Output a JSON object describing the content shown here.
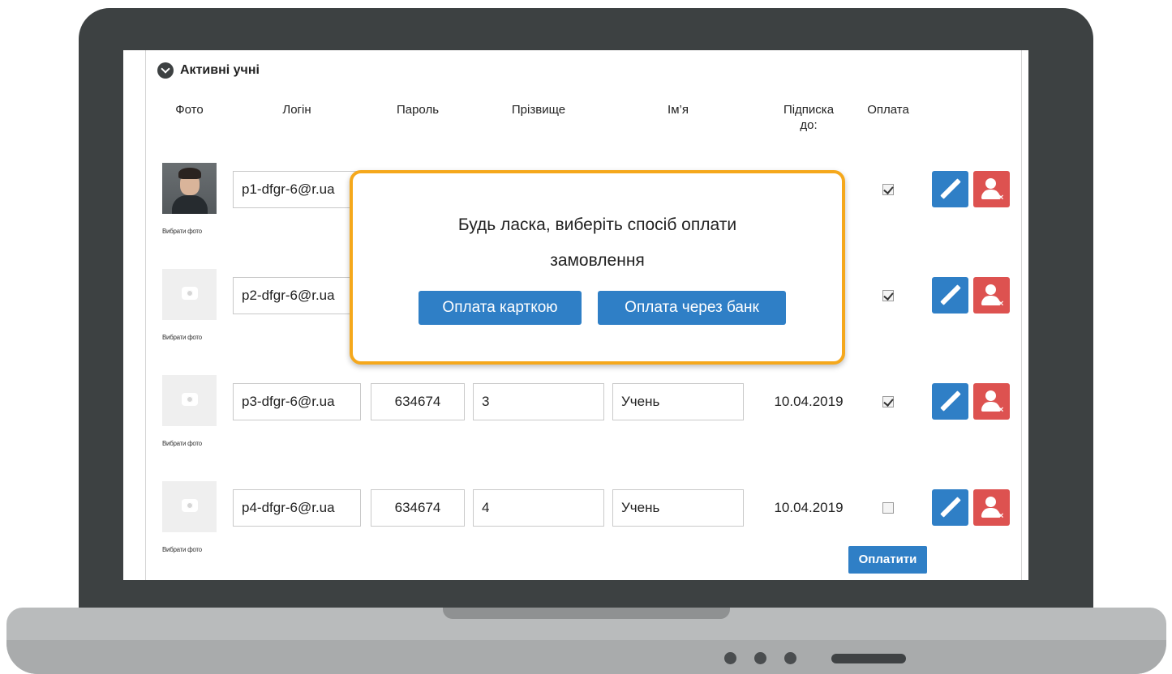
{
  "section": {
    "title": "Активні учні"
  },
  "columns": {
    "photo": "Фото",
    "login": "Логін",
    "password": "Пароль",
    "surname": "Прізвище",
    "name": "Ім’я",
    "subscription_line1": "Підписка",
    "subscription_line2": "до:",
    "payment": "Оплата"
  },
  "choose_photo_label": "Вибрати фото",
  "students": [
    {
      "login": "p1-dfgr-6@r.ua",
      "has_photo": true,
      "paid": true
    },
    {
      "login": "p2-dfgr-6@r.ua",
      "has_photo": false,
      "paid": true
    },
    {
      "login": "p3-dfgr-6@r.ua",
      "password": "634674",
      "surname": "3",
      "name": "Учень",
      "subscription_until": "10.04.2019",
      "has_photo": false,
      "paid": true
    },
    {
      "login": "p4-dfgr-6@r.ua",
      "password": "634674",
      "surname": "4",
      "name": "Учень",
      "subscription_until": "10.04.2019",
      "has_photo": false,
      "paid": false
    }
  ],
  "pay_button_label": "Оплатити",
  "popup": {
    "line1": "Будь ласка, виберіть спосіб оплати",
    "line2": "замовлення",
    "card_button": "Оплата карткою",
    "bank_button": "Оплата через банк"
  },
  "colors": {
    "primary_blue": "#2f7fc6",
    "danger_red": "#dd5250",
    "popup_border": "#f5a81c",
    "laptop_bezel": "#3d4142"
  },
  "icons": [
    "chevron-down-icon",
    "camera-icon",
    "pencil-icon",
    "user-remove-icon",
    "checkbox-icon"
  ]
}
